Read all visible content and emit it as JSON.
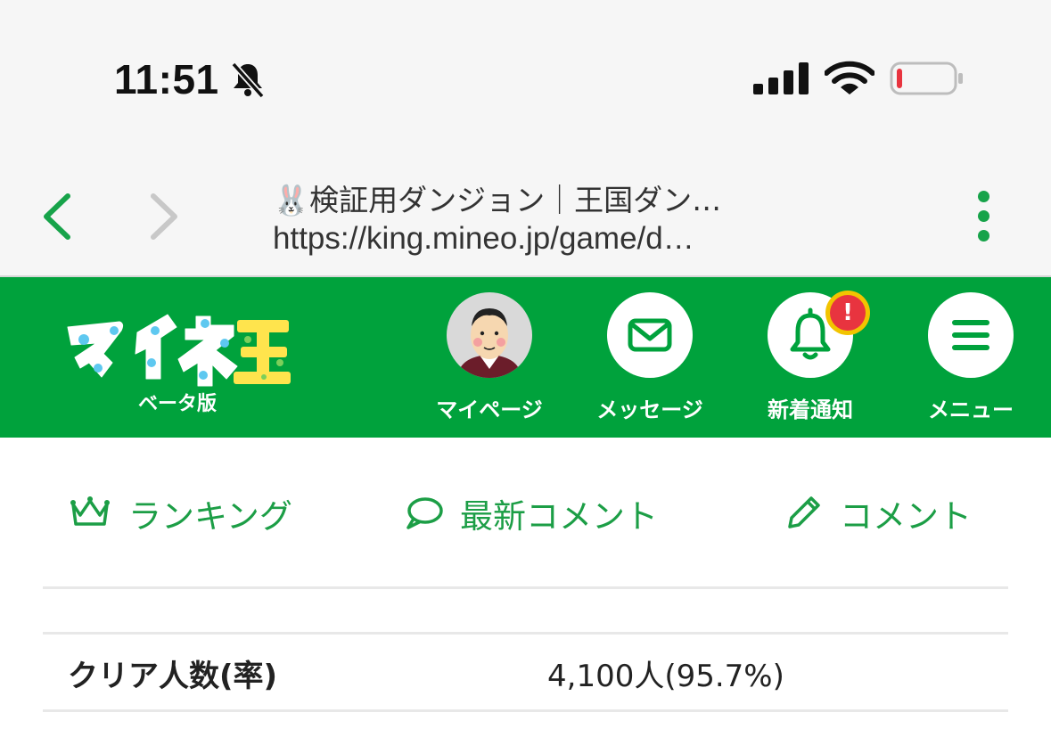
{
  "status_bar": {
    "time": "11:51",
    "icons": [
      "bell-slash-icon",
      "cellular-signal-icon",
      "wifi-icon",
      "battery-low-icon"
    ],
    "battery_color": "#e8343f"
  },
  "browser": {
    "title": "🐰検証用ダンジョン｜王国ダン…",
    "url": "https://king.mineo.jp/game/d…",
    "accent_color": "#17a34a"
  },
  "header": {
    "logo_text": "マイネ王",
    "logo_sub": "ベータ版",
    "background_color": "#00a23c",
    "nav": [
      {
        "label": "マイページ",
        "icon": "avatar"
      },
      {
        "label": "メッセージ",
        "icon": "envelope-icon"
      },
      {
        "label": "新着通知",
        "icon": "bell-icon",
        "badge": "!"
      },
      {
        "label": "メニュー",
        "icon": "hamburger-menu-icon"
      }
    ]
  },
  "tabs": [
    {
      "label": "ランキング",
      "icon": "crown-icon"
    },
    {
      "label": "最新コメント",
      "icon": "speech-bubble-icon"
    },
    {
      "label": "コメント",
      "icon": "pencil-icon"
    }
  ],
  "stats": {
    "clear_label": "クリア人数(率)",
    "clear_value": "4,100人(95.7%)"
  }
}
